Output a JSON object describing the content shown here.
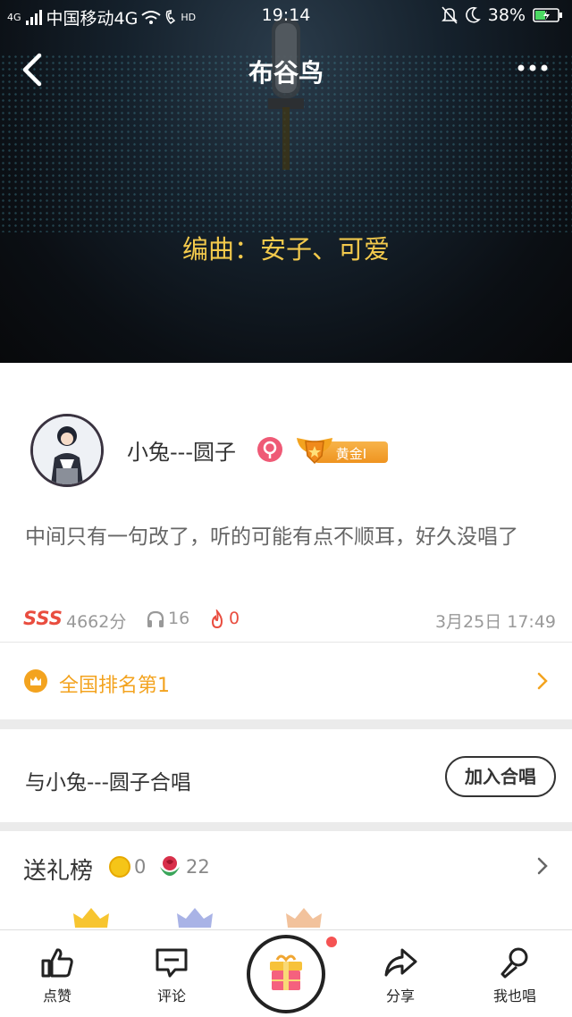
{
  "status_bar": {
    "network_type": "4G",
    "carrier": "中国移动4G",
    "hd_label": "HD",
    "time": "19:14",
    "battery": "38%"
  },
  "header": {
    "title": "布谷鸟",
    "caption": "编曲：安子、可爱"
  },
  "user": {
    "name": "小兔---圆子",
    "gender_icon": "female-icon",
    "level_label": "黄金I"
  },
  "post": {
    "description": "中间只有一句改了，听的可能有点不顺耳，好久没唱了",
    "grade": "SSS",
    "score": "4662分",
    "listens": "16",
    "hot_count": "0",
    "date": "3月25日 17:49"
  },
  "ranking": {
    "label": "全国排名第1"
  },
  "duet": {
    "label": "与小兔---圆子合唱",
    "button_label": "加入合唱"
  },
  "gifts": {
    "title": "送礼榜",
    "coins": "0",
    "flowers": "22"
  },
  "tabs": [
    {
      "label": "点赞",
      "icon": "thumbs-up-icon"
    },
    {
      "label": "评论",
      "icon": "comment-icon"
    },
    {
      "label": "分享",
      "icon": "share-icon"
    },
    {
      "label": "我也唱",
      "icon": "microphone-icon"
    }
  ],
  "colors": {
    "accent": "#f3a31f",
    "caption": "#f2c94c",
    "red": "#e94d3f"
  }
}
